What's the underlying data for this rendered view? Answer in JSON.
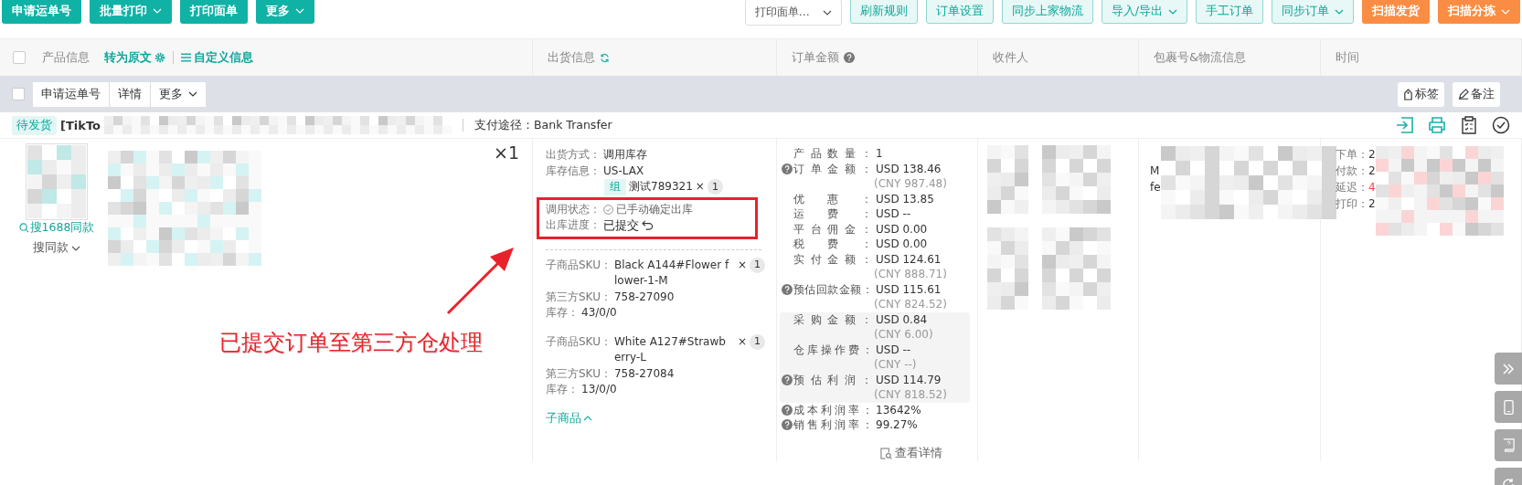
{
  "toolbar": {
    "left_buttons": [
      {
        "label": "申请运单号",
        "dropdown": false
      },
      {
        "label": "批量打印",
        "dropdown": true
      },
      {
        "label": "打印面单",
        "dropdown": false
      },
      {
        "label": "更多",
        "dropdown": true
      }
    ],
    "select": {
      "value": "打印面单…"
    },
    "right_buttons": [
      {
        "label": "刷新规则",
        "kind": "outline",
        "dropdown": false
      },
      {
        "label": "订单设置",
        "kind": "outline",
        "dropdown": false
      },
      {
        "label": "同步上家物流",
        "kind": "outline",
        "dropdown": false
      },
      {
        "label": "导入/导出",
        "kind": "outline",
        "dropdown": true
      },
      {
        "label": "手工订单",
        "kind": "outline",
        "dropdown": false
      },
      {
        "label": "同步订单",
        "kind": "outline",
        "dropdown": true
      },
      {
        "label": "扫描发货",
        "kind": "orange",
        "dropdown": false
      },
      {
        "label": "扫描分拣",
        "kind": "orange",
        "dropdown": true
      }
    ]
  },
  "table": {
    "select_all": {
      "checked": false
    },
    "columns": [
      {
        "label": "产品信息"
      },
      {
        "label": "出货信息"
      },
      {
        "label": "订单金额"
      },
      {
        "label": "收件人"
      },
      {
        "label": "包裹号&物流信息"
      },
      {
        "label": "时间"
      }
    ],
    "header_links": [
      {
        "label": "转为原文"
      },
      {
        "label": "自定义信息"
      }
    ],
    "bulk_bar": {
      "checked": false,
      "buttons": [
        {
          "label": "申请运单号",
          "dropdown": false
        },
        {
          "label": "详情",
          "dropdown": false
        },
        {
          "label": "更多",
          "dropdown": true
        }
      ],
      "right_buttons": [
        {
          "label": "标签"
        },
        {
          "label": "备注"
        }
      ]
    },
    "order": {
      "status": "待发货",
      "store_prefix": "[TikTo",
      "payment": "支付途径：Bank Transfer",
      "product": {
        "search_link": "搜1688同款",
        "similar": "搜同款",
        "quantity": "×1"
      },
      "shipping": {
        "rows": [
          {
            "label": "出货方式：",
            "value": "调用库存"
          },
          {
            "label": "库存信息：",
            "value": "US-LAX"
          }
        ],
        "group": {
          "tag": "组",
          "name": "测试789321",
          "times": "×",
          "count": "1"
        },
        "status_rows": [
          {
            "label": "调用状态：",
            "value": "已手动确定出库"
          },
          {
            "label": "出库进度：",
            "value": "已提交"
          }
        ],
        "skus": [
          {
            "label": "子商品SKU：",
            "value": "Black A144#Flower flower-1-M",
            "times": "×",
            "count": "1",
            "third_label": "第三方SKU：",
            "third": "758-27090",
            "stock_label": "库存：",
            "stock": "43/0/0"
          },
          {
            "label": "子商品SKU：",
            "value": "White A127#Strawberry-L",
            "times": "×",
            "count": "1",
            "third_label": "第三方SKU：",
            "third": "758-27084",
            "stock_label": "库存：",
            "stock": "13/0/0"
          }
        ],
        "collapse_link": "子商品"
      },
      "amount_groups": [
        {
          "kind": "plain",
          "rows": [
            {
              "label": "产品数量：",
              "value": "1",
              "help": false
            },
            {
              "label": "订单金额：",
              "value": "USD 138.46",
              "sub": "(CNY 987.48)",
              "help": true
            },
            {
              "label": "优惠：",
              "value": "USD 13.85",
              "help": false
            },
            {
              "label": "运费：",
              "value": "USD --",
              "help": false
            },
            {
              "label": "平台佣金：",
              "value": "USD 0.00",
              "help": false
            },
            {
              "label": "税费：",
              "value": "USD 0.00",
              "help": false
            },
            {
              "label": "实付金额：",
              "value": "USD 124.61",
              "sub": "(CNY 888.71)",
              "help": false
            },
            {
              "label": "预估回款金额：",
              "value": "USD 115.61",
              "sub": "(CNY 824.52)",
              "help": true
            }
          ]
        },
        {
          "kind": "shaded",
          "rows": [
            {
              "label": "采购金额：",
              "value": "USD 0.84",
              "sub": "(CNY 6.00)",
              "help": false
            },
            {
              "label": "仓库操作费：",
              "value": "USD --",
              "sub": "(CNY --)",
              "help": false
            },
            {
              "label": "预估利润：",
              "value": "USD 114.79",
              "sub": "(CNY 818.52)",
              "help": true
            }
          ]
        },
        {
          "kind": "plain",
          "rows": [
            {
              "label": "成本利润率：",
              "value": "13642%",
              "help": true
            },
            {
              "label": "销售利润率：",
              "value": "99.27%",
              "help": true
            }
          ]
        }
      ],
      "details_link": "查看详情",
      "package_lines": [
        "M",
        "fe"
      ],
      "time_lines": [
        {
          "label": "下单：",
          "value": "2",
          "alert": false
        },
        {
          "label": "付款：",
          "value": "2",
          "alert": false
        },
        {
          "label": "延迟：",
          "value": "4",
          "alert": true
        },
        {
          "label": "打印：",
          "value": "2",
          "alert": false
        }
      ]
    }
  },
  "annotation": {
    "text": "已提交订单至第三方仓处理"
  }
}
